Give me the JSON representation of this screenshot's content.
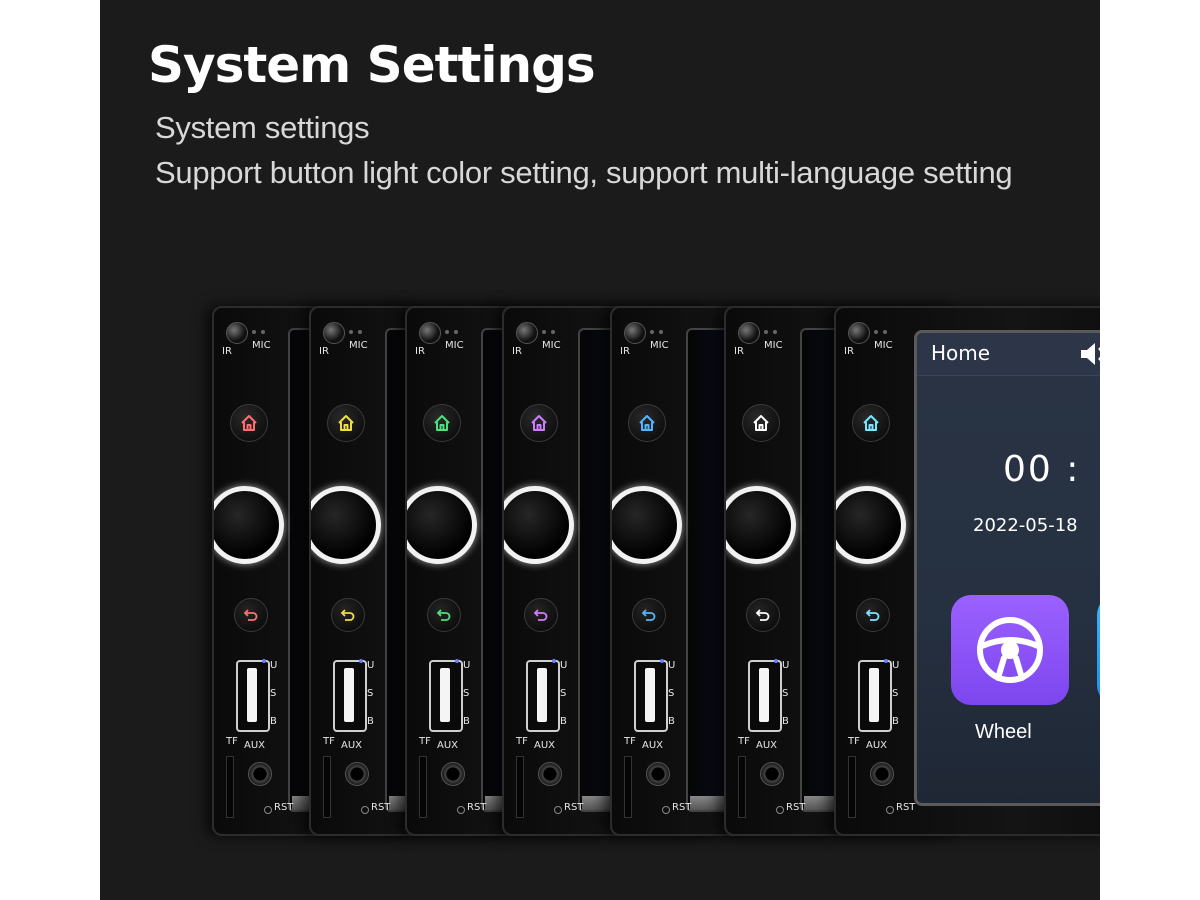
{
  "header": {
    "title": "System Settings",
    "subtitle": "System settings",
    "description": "Support button light color setting, support multi-language setting"
  },
  "panel_labels": {
    "ir": "IR",
    "mic": "MIC",
    "u": "U",
    "s": "S",
    "b": "B",
    "tf": "TF",
    "aux": "AUX",
    "rst": "RST"
  },
  "button_light_colors": [
    "#ff6f6f",
    "#f0e040",
    "#4ee07a",
    "#d07cff",
    "#52b6ff",
    "#ffffff",
    "#78e6ff"
  ],
  "screen": {
    "title": "Home",
    "clock": "00 :",
    "date": "2022-05-18",
    "app_label": "Wheel",
    "background_color": "#253040",
    "app_icon_color": "#8a52f7"
  },
  "icons": {
    "home": "home-icon",
    "back": "back-arrow-icon",
    "volume": "speaker-mute-icon",
    "app": "steering-wheel-icon"
  }
}
